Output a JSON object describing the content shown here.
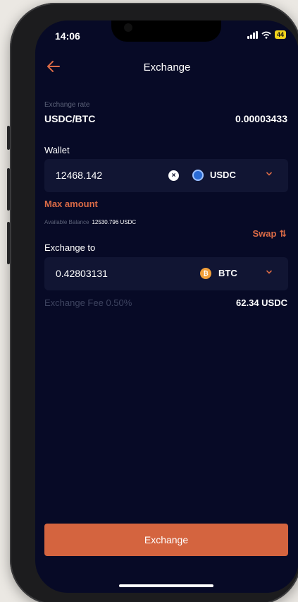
{
  "status": {
    "time": "14:06",
    "battery": "44"
  },
  "header": {
    "title": "Exchange"
  },
  "rate": {
    "label": "Exchange rate",
    "pair": "USDC/BTC",
    "value": "0.00003433"
  },
  "wallet": {
    "label": "Wallet",
    "amount": "12468.142",
    "coin": "USDC",
    "clear_symbol": "×"
  },
  "max_amount": "Max amount",
  "available": {
    "label": "Available Balance",
    "value": "12530.796 USDC"
  },
  "swap": {
    "label": "Swap",
    "icon": "⇅"
  },
  "exchange_to": {
    "label": "Exchange to",
    "amount": "0.42803131",
    "coin": "BTC",
    "coin_symbol": "₿"
  },
  "fee": {
    "label": "Exchange Fee 0.50%",
    "value": "62.34 USDC"
  },
  "cta": {
    "label": "Exchange"
  },
  "colors": {
    "accent": "#d4643f",
    "background": "#070a26",
    "field": "#111533"
  },
  "icons": [
    "back-arrow-icon",
    "clear-icon",
    "usdc-coin-icon",
    "btc-coin-icon",
    "chevron-down-icon",
    "swap-icon"
  ]
}
